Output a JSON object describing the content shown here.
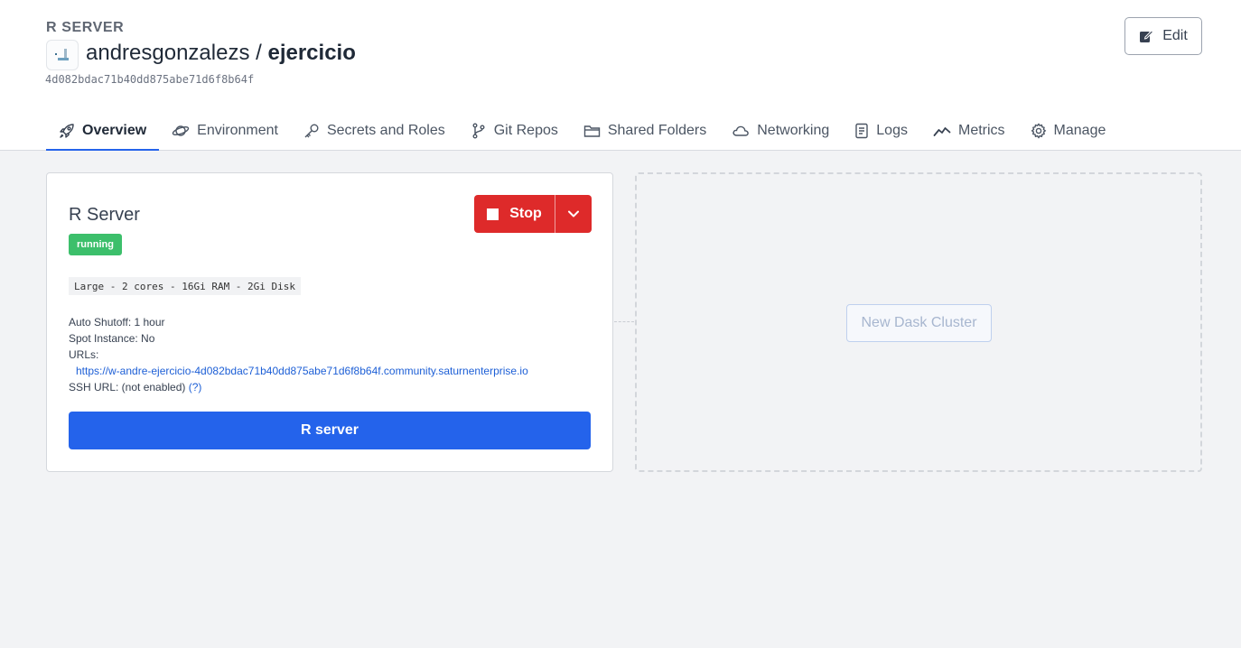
{
  "resource": {
    "type_label": "R SERVER",
    "owner": "andresgonzalezs",
    "separator": " / ",
    "name": "ejercicio",
    "id": "4d082bdac71b40dd875abe71d6f8b64f"
  },
  "actions": {
    "edit_label": "Edit"
  },
  "tabs": [
    {
      "label": "Overview",
      "icon": "rocket-icon",
      "active": true
    },
    {
      "label": "Environment",
      "icon": "planet-icon"
    },
    {
      "label": "Secrets and Roles",
      "icon": "key-icon"
    },
    {
      "label": "Git Repos",
      "icon": "git-branch-icon"
    },
    {
      "label": "Shared Folders",
      "icon": "folder-icon"
    },
    {
      "label": "Networking",
      "icon": "cloud-icon"
    },
    {
      "label": "Logs",
      "icon": "document-icon"
    },
    {
      "label": "Metrics",
      "icon": "trend-icon"
    },
    {
      "label": "Manage",
      "icon": "gear-icon"
    }
  ],
  "card": {
    "title": "R Server",
    "status": "running",
    "stop_label": "Stop",
    "instance_size": "Large - 2 cores - 16Gi RAM - 2Gi Disk",
    "auto_shutoff": "Auto Shutoff: 1 hour",
    "spot_instance": "Spot Instance: No",
    "urls_label": "URLs:",
    "url": "https://w-andre-ejercicio-4d082bdac71b40dd875abe71d6f8b64f.community.saturnenterprise.io",
    "ssh_url": "SSH URL: (not enabled)",
    "ssh_help": "(?)",
    "open_button": "R server"
  },
  "dask": {
    "new_cluster_label": "New Dask Cluster"
  },
  "colors": {
    "primary": "#2463eb",
    "danger": "#de2a2a",
    "success": "#3cbf6b",
    "background": "#f2f3f5"
  }
}
